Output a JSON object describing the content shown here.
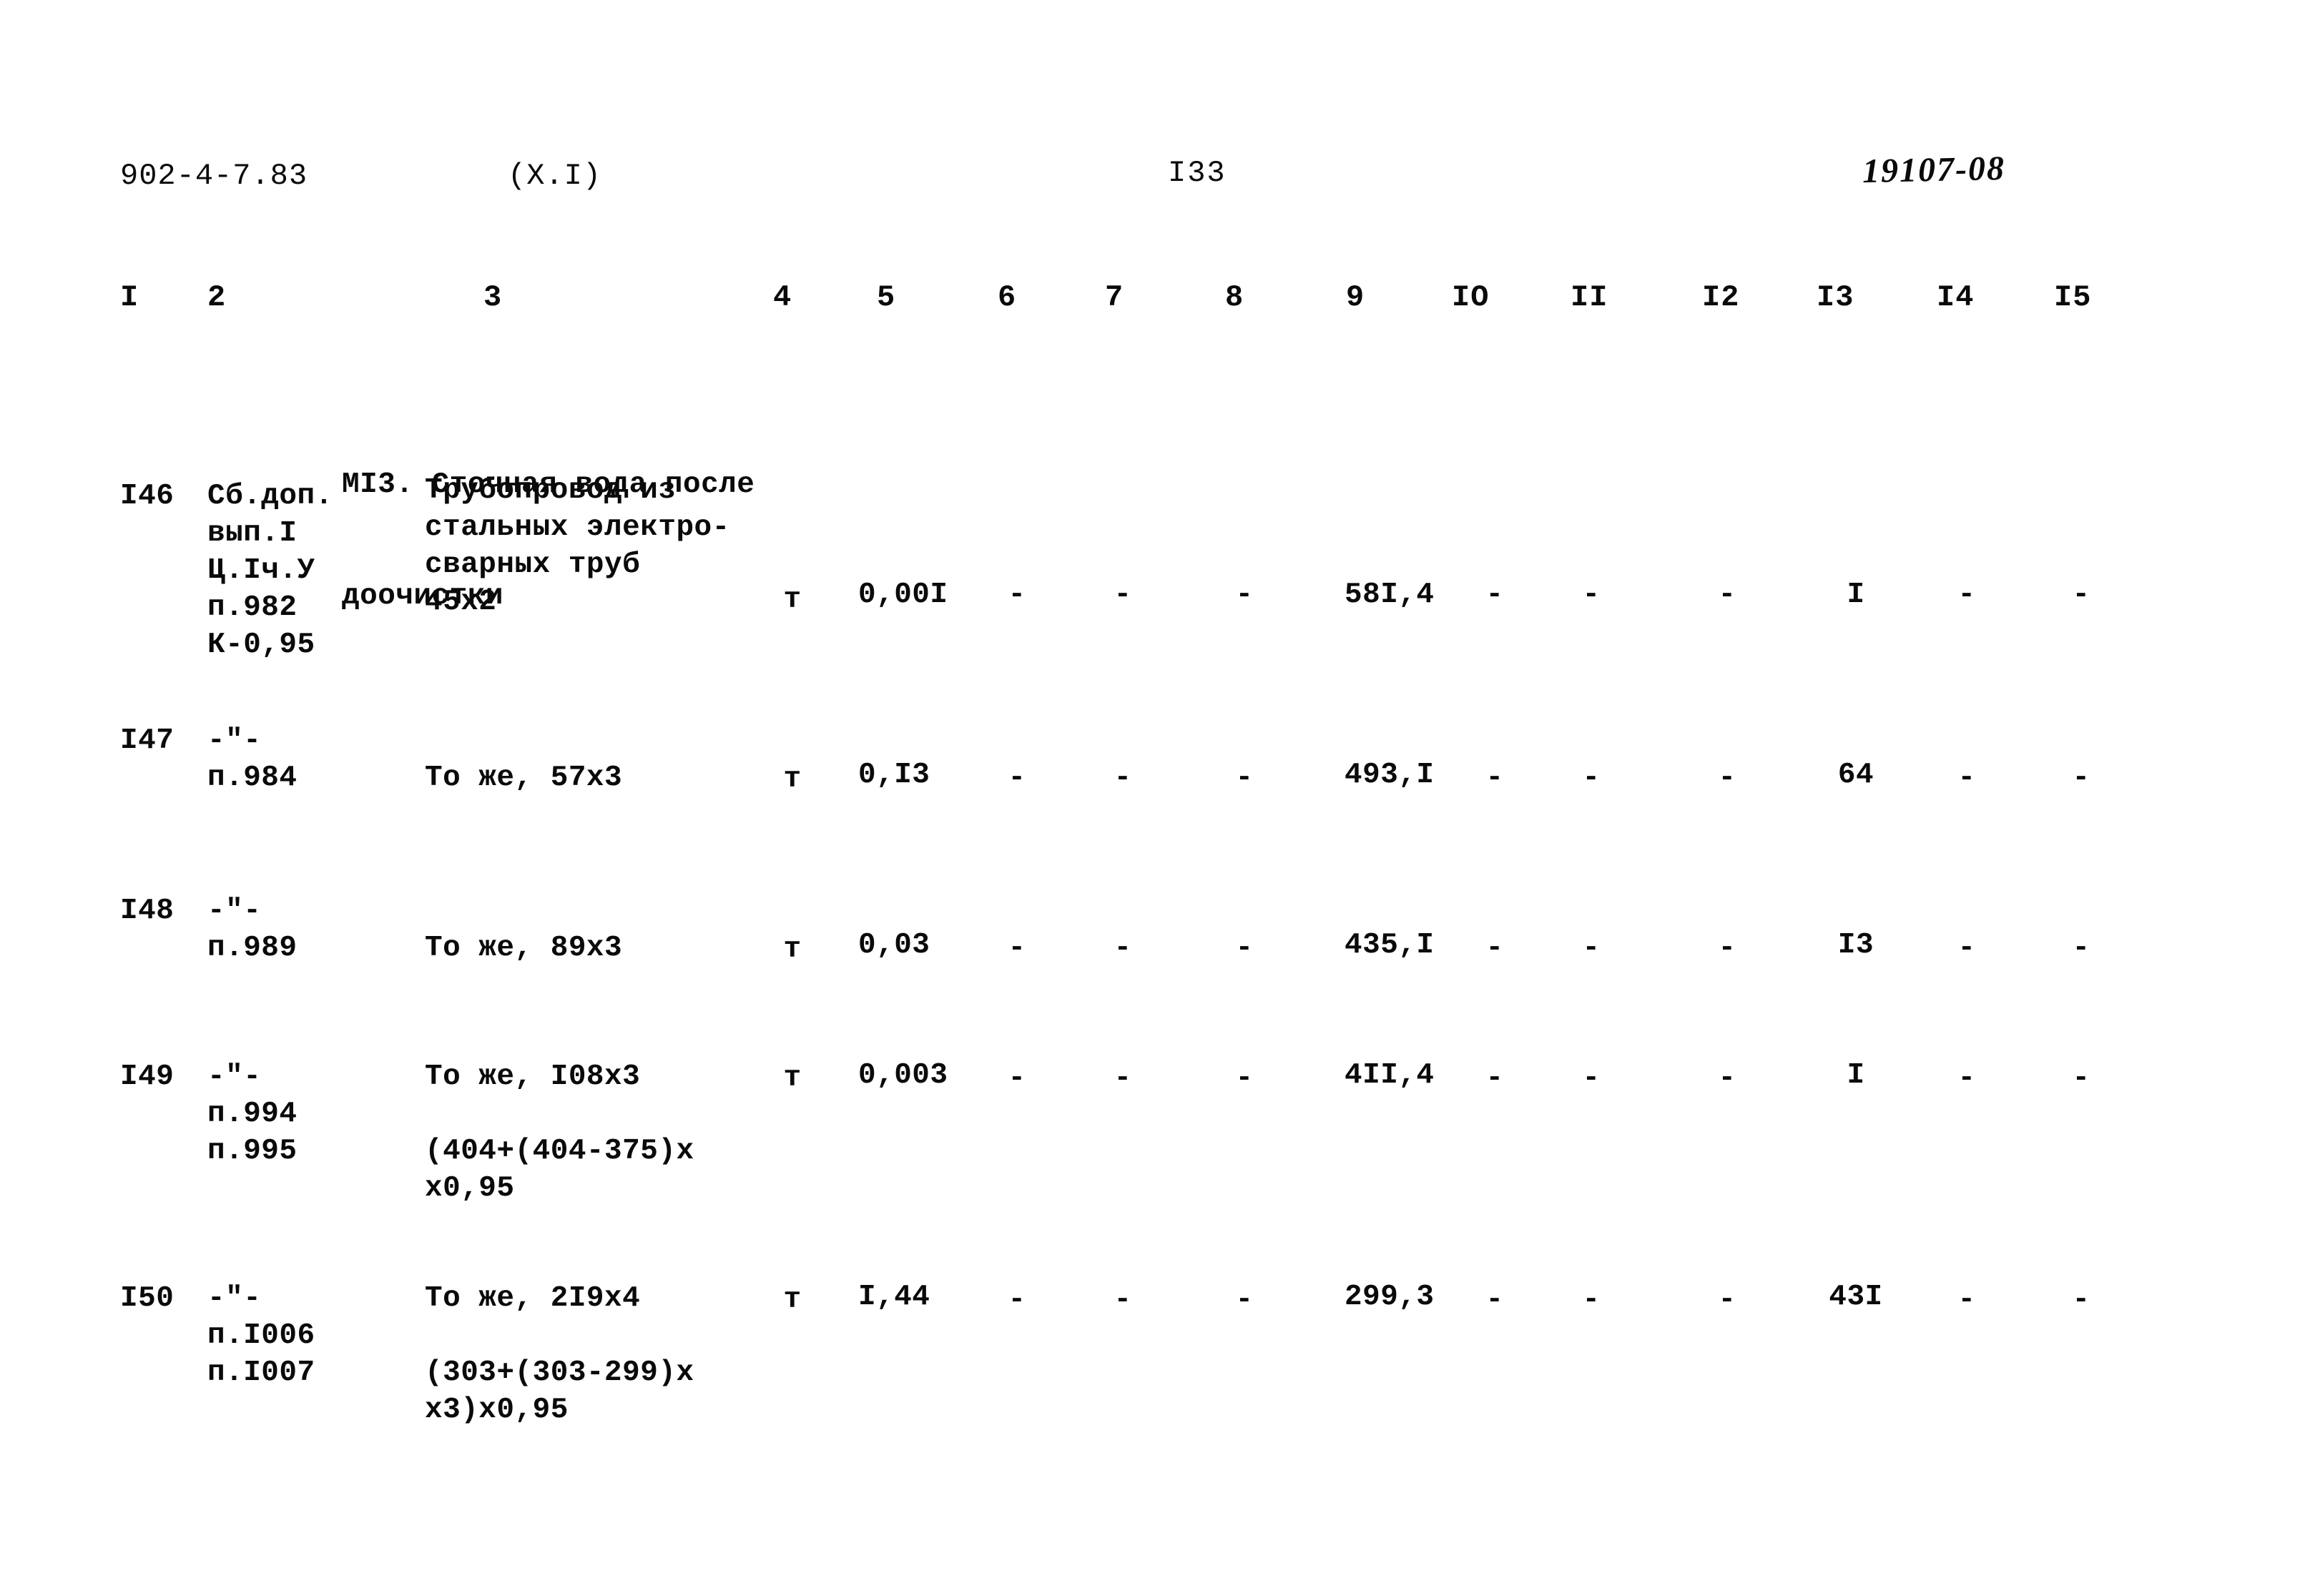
{
  "header": {
    "document_code": "902-4-7.83",
    "chapter": "(X.I)",
    "page_number": "I33",
    "archive_stamp": "19107-08"
  },
  "table": {
    "column_numbers": [
      "I",
      "2",
      "3",
      "4",
      "5",
      "6",
      "7",
      "8",
      "9",
      "IO",
      "II",
      "I2",
      "I3",
      "I4",
      "I5"
    ],
    "dash_rule": "- - - - - - - - - - - - - - - - - - - - - - - - - - - - - - - - - - - - - - - - - - - - - - - - - - - - - - - - - - - - - - - -",
    "section_title_line1": "МI3. Сточная вода после",
    "section_title_line2": "доочистки",
    "rows": [
      {
        "number": "I46",
        "justification": "Сб.доп.\nвып.I\nЦ.Iч.У\nп.982\nК-0,95",
        "description": "Трубопровод из\nстальных электро-\nсварных труб\n45х2",
        "unit": "т",
        "qty": "0,00I",
        "col6": "-",
        "col7": "-",
        "col8": "-",
        "col9": "58I,4",
        "col10": "-",
        "col11": "-",
        "col12": "-",
        "col13": "I",
        "col14": "-",
        "col15": "-"
      },
      {
        "number": "I47",
        "justification": "-\"-\nп.984",
        "description": "То же, 57х3",
        "unit": "т",
        "qty": "0,I3",
        "col6": "-",
        "col7": "-",
        "col8": "-",
        "col9": "493,I",
        "col10": "-",
        "col11": "-",
        "col12": "-",
        "col13": "64",
        "col14": "-",
        "col15": "-"
      },
      {
        "number": "I48",
        "justification": "-\"-\nп.989",
        "description": "То же, 89х3",
        "unit": "т",
        "qty": "0,03",
        "col6": "-",
        "col7": "-",
        "col8": "-",
        "col9": "435,I",
        "col10": "-",
        "col11": "-",
        "col12": "-",
        "col13": "I3",
        "col14": "-",
        "col15": "-"
      },
      {
        "number": "I49",
        "justification": "-\"-\nп.994\nп.995",
        "description": "То же, I08х3\n\n(404+(404-375)х\nх0,95",
        "unit": "т",
        "qty": "0,003",
        "col6": "-",
        "col7": "-",
        "col8": "-",
        "col9": "4II,4",
        "col10": "-",
        "col11": "-",
        "col12": "-",
        "col13": "I",
        "col14": "-",
        "col15": "-"
      },
      {
        "number": "I50",
        "justification": "-\"-\nп.I006\nп.I007",
        "description": "То же, 2I9х4\n\n(303+(303-299)х\nх3)х0,95",
        "unit": "т",
        "qty": "I,44",
        "col6": "-",
        "col7": "-",
        "col8": "-",
        "col9": "299,3",
        "col10": "-",
        "col11": "-",
        "col12": "-",
        "col13": "43I",
        "col14": "-",
        "col15": "-"
      }
    ]
  }
}
